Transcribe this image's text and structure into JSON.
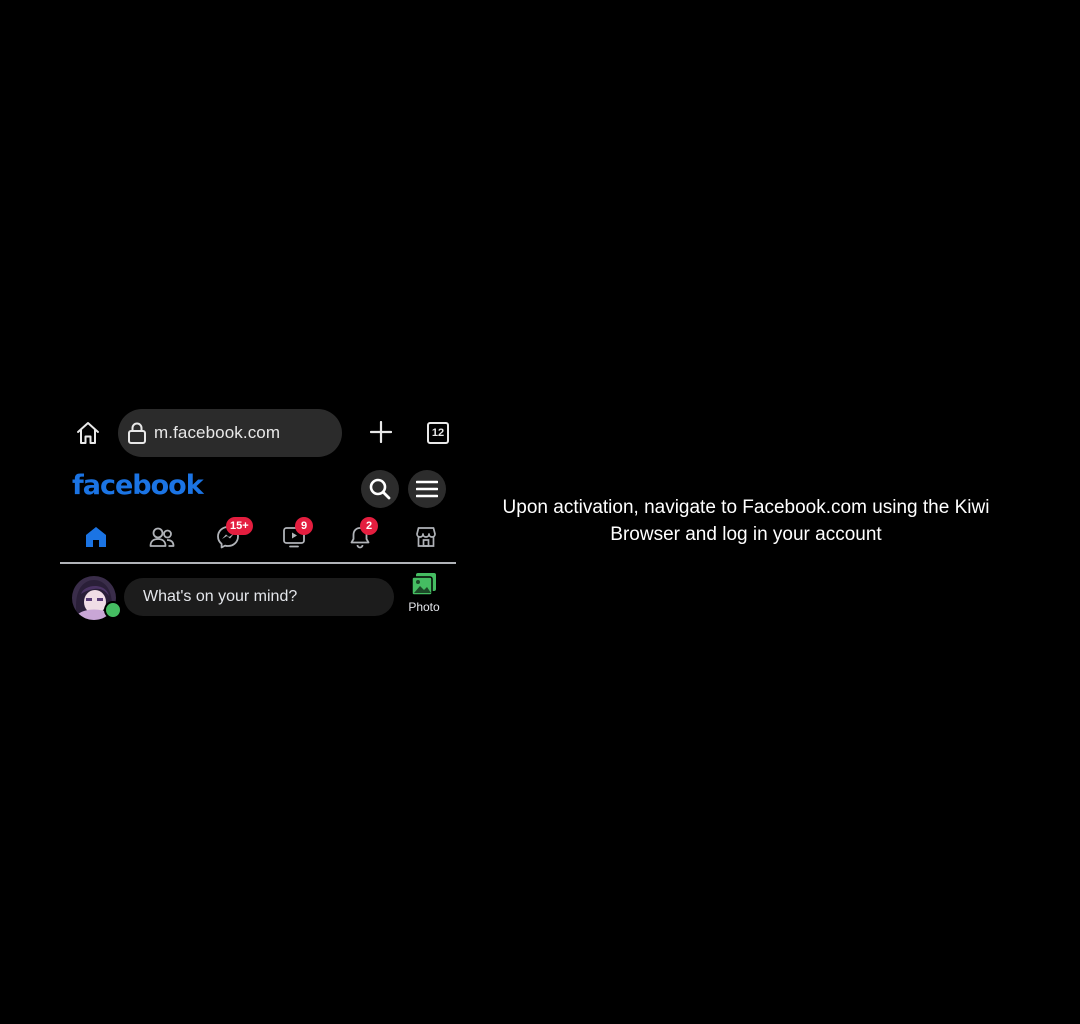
{
  "browser": {
    "url": "m.facebook.com",
    "tab_count": "12"
  },
  "facebook": {
    "logo_text": "facebook",
    "brand_color": "#1b74e4",
    "nav": {
      "active_tab": "home",
      "messages_badge": "15+",
      "watch_badge": "9",
      "notifications_badge": "2"
    },
    "composer": {
      "placeholder": "What's on your mind?",
      "photo_label": "Photo"
    }
  },
  "instruction": {
    "text": "Upon activation, navigate to Facebook.com using the Kiwi Browser and log in your account"
  },
  "icons": [
    "home-icon",
    "lock-icon",
    "plus-icon",
    "tab-switcher-icon",
    "search-icon",
    "menu-icon",
    "friends-icon",
    "messenger-icon",
    "watch-icon",
    "bell-icon",
    "marketplace-icon",
    "photo-icon"
  ],
  "colors": {
    "background": "#000000",
    "badge": "#e41e3f",
    "online": "#45bd62",
    "photo_green": "#45bd62"
  }
}
